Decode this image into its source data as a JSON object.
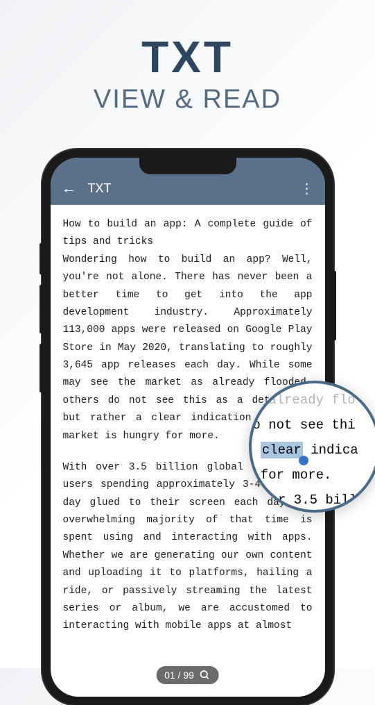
{
  "header": {
    "title_main": "TXT",
    "title_sub": "VIEW & READ"
  },
  "app_bar": {
    "back_icon": "←",
    "title": "TXT",
    "more_icon": "⋮"
  },
  "document": {
    "paragraph1": "How to build an app: A complete guide of tips and tricks",
    "paragraph2": "Wondering how to build an app? Well, you're not alone. There has never been a better time to get into the app development industry. Approximately 113,000 apps were released on Google Play Store in May 2020, translating to roughly 3,645 app releases each day. While some may see the market as already flooded, others do not see this as a deterrent, but rather a clear indication that the market is hungry for more.",
    "paragraph3": "With over 3.5 billion global smartphone users spending approximately 3-4 hours a day glued to their screen each day, an overwhelming majority of that time is spent using and interacting with apps. Whether we are generating our own content and uploading it to platforms, hailing a ride, or passively streaming the latest series or album, we are accustomed to interacting with mobile apps at almost"
  },
  "magnifier": {
    "line1": "as already flo   mark",
    "line2_pre": "do not see thi",
    "line3_pre": " a ",
    "line3_highlight": "clear",
    "line3_post": " indica",
    "line4": "y for more.",
    "line5": " ",
    "line6": "r 3.5 bill"
  },
  "page_indicator": {
    "text": "01 / 99"
  }
}
